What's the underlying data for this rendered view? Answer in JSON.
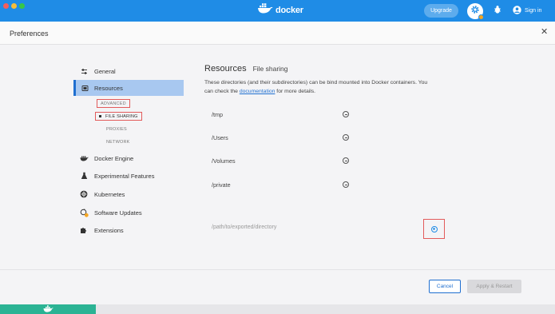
{
  "colors": {
    "brand_blue": "#1f8ce6",
    "active_bg": "#a8c8f0",
    "highlight_red": "#e25b5b",
    "status_green": "#2bb394"
  },
  "titlebar": {
    "brand": "docker",
    "upgrade_label": "Upgrade",
    "signin_label": "Sign in"
  },
  "preferences": {
    "title": "Preferences",
    "close_glyph": "✕"
  },
  "sidebar": {
    "items": [
      {
        "label": "General",
        "icon": "sliders-icon"
      },
      {
        "label": "Resources",
        "icon": "disk-icon",
        "active": true
      },
      {
        "label": "Docker Engine",
        "icon": "whale-icon"
      },
      {
        "label": "Experimental Features",
        "icon": "flask-icon"
      },
      {
        "label": "Kubernetes",
        "icon": "helm-icon"
      },
      {
        "label": "Software Updates",
        "icon": "update-icon"
      },
      {
        "label": "Extensions",
        "icon": "puzzle-icon"
      }
    ],
    "resources_sub": [
      "ADVANCED",
      "FILE SHARING",
      "PROXIES",
      "NETWORK"
    ]
  },
  "content": {
    "title": "Resources",
    "subtitle": "File sharing",
    "desc_before": "These directories (and their subdirectories) can be bind mounted into Docker containers. You can check the ",
    "desc_link": "documentation",
    "desc_after": " for more details.",
    "paths": [
      "/tmp",
      "/Users",
      "/Volumes",
      "/private"
    ],
    "new_path_placeholder": "/path/to/exported/directory"
  },
  "footer": {
    "cancel_label": "Cancel",
    "apply_label": "Apply & Restart"
  }
}
